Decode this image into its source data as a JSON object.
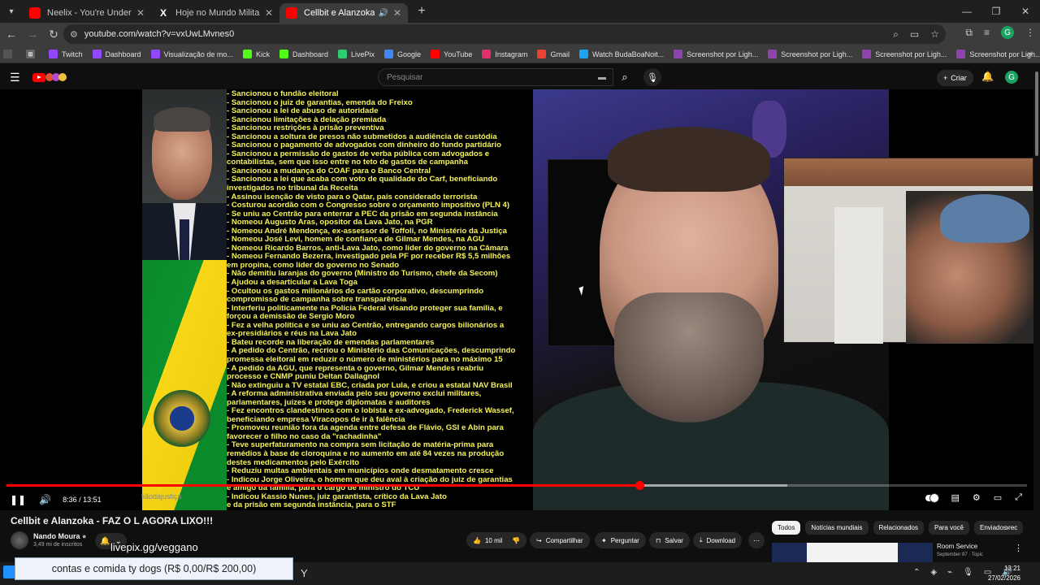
{
  "browser": {
    "tabs": [
      {
        "title": "Neelix - You're Under Control (...",
        "icon": "youtube-icon",
        "active": false
      },
      {
        "title": "Hoje no Mundo Militar (@hoje...",
        "icon": "x-icon",
        "active": false
      },
      {
        "title": "Cellbit e Alanzoka - FAZ O L...",
        "icon": "youtube-icon",
        "active": true
      }
    ],
    "url": "youtube.com/watch?v=vxUwLMvnes0",
    "bookmarks": [
      {
        "label": "Twitch",
        "color": "#9146ff"
      },
      {
        "label": "Dashboard",
        "color": "#9146ff"
      },
      {
        "label": "Visualização de mo...",
        "color": "#9146ff"
      },
      {
        "label": "Kick",
        "color": "#53fc18"
      },
      {
        "label": "Dashboard",
        "color": "#53fc18"
      },
      {
        "label": "LivePix",
        "color": "#2ecc71"
      },
      {
        "label": "Google",
        "color": "#4285f4"
      },
      {
        "label": "YouTube",
        "color": "#ff0000"
      },
      {
        "label": "Instagram",
        "color": "#e1306c"
      },
      {
        "label": "Gmail",
        "color": "#ea4335"
      },
      {
        "label": "Watch BudaBoaNoit...",
        "color": "#1da1f2"
      },
      {
        "label": "Screenshot por Ligh...",
        "color": "#8e44ad"
      },
      {
        "label": "Screenshot por Ligh...",
        "color": "#8e44ad"
      },
      {
        "label": "Screenshot por Ligh...",
        "color": "#8e44ad"
      },
      {
        "label": "Screenshot por Ligh...",
        "color": "#8e44ad"
      }
    ]
  },
  "youtube": {
    "search_placeholder": "Pesquisar",
    "create_label": "Criar",
    "avatar_letter": "G"
  },
  "video": {
    "text_lines": [
      "- Sancionou o fundão eleitoral",
      "- Sancionou o juiz de garantias, emenda do Freixo",
      "- Sancionou a lei de abuso de autoridade",
      "- Sancionou limitações à delação premiada",
      "- Sancionou restrições à prisão preventiva",
      "- Sancionou a soltura de presos não submetidos a audiência de custódia",
      "- Sancionou o pagamento de advogados com dinheiro do fundo partidário",
      "- Sancionou a permissão de gastos de verba pública com advogados e",
      "contabilistas, sem que isso entre no teto de gastos de campanha",
      "- Sancionou a mudança do COAF para o Banco Central",
      "- Sancionou a lei que acaba com voto de qualidade do Carf, beneficiando",
      "investigados no tribunal da Receita",
      "- Assinou isenção de visto para o Qatar, país considerado terrorista",
      "- Costurou acordão com o Congresso sobre o orçamento impositivo (PLN 4)",
      "- Se uniu ao Centrão para enterrar a PEC da prisão em segunda instância",
      "- Nomeou Augusto Aras, opositor da Lava Jato, na PGR",
      "- Nomeou André Mendonça, ex-assessor de Toffoli, no Ministério da Justiça",
      "- Nomeou José Levi, homem de confiança de Gilmar Mendes, na AGU",
      "- Nomeou Ricardo Barros, anti-Lava Jato, como líder do governo na Câmara",
      "- Nomeou Fernando Bezerra, investigado pela PF por receber R$ 5,5 milhões",
      "em propina, como líder do governo no Senado",
      "- Não demitiu laranjas do governo (Ministro do Turismo, chefe da Secom)",
      "- Ajudou a desarticular a Lava Toga",
      "- Ocultou os gastos milionários do cartão corporativo, descumprindo",
      "compromisso de campanha sobre transparência",
      "- Interferiu politicamente na Polícia Federal visando proteger sua família, e",
      "forçou a demissão de Sergio Moro",
      "- Fez a velha política e se uniu ao Centrão, entregando cargos bilionários a",
      "ex-presidiários e réus na Lava Jato",
      "- Bateu recorde na liberação de emendas parlamentares",
      "- A pedido do Centrão, recriou o Ministério das Comunicações, descumprindo",
      "promessa eleitoral em reduzir o número de ministérios para no máximo 15",
      "- A pedido da AGU, que representa o governo, Gilmar Mendes reabriu",
      "processo e CNMP puniu Deltan Dallagnol",
      "- Não extinguiu a TV estatal EBC, criada por Lula, e criou a estatal NAV Brasil",
      "- A reforma administrativa enviada pelo seu governo exclui militares,",
      "parlamentares, juízes e protege diplomatas e auditores",
      "- Fez encontros clandestinos com o lobista e ex-advogado, Frederick Wassef,",
      "beneficiando empresa Viracopos de ir à falência",
      "- Promoveu reunião fora da agenda entre defesa de Flávio, GSI e Abin para",
      "favorecer o filho no caso da \"rachadinha\"",
      "- Teve superfaturamento na compra sem licitação de matéria-prima para",
      "remédios à base de cloroquina e no aumento em até 84 vezes na produção",
      "destes medicamentos pelo Exército",
      "- Reduziu multas ambientais em municípios onde desmatamento cresce",
      "- Indicou Jorge Oliveira, o homem que deu aval à criação do juiz de garantias",
      "e amigo da família, para o cargo de ministro do TCU",
      "- Indicou Kassio Nunes, juiz garantista, crítico da Lava Jato",
      "e da prisão em segunda instância, para o STF"
    ],
    "watermark": "liãodajustiça",
    "current_time": "8:36",
    "duration": "13:51",
    "played_fraction": 0.62,
    "loaded_fraction": 0.765,
    "title": "Cellbit e Alanzoka - FAZ O L AGORA LIXO!!!",
    "channel_name": "Nando Moura",
    "subscribers": "3,49 mi de inscritos",
    "overlay_link": "livepix.gg/veggano",
    "likes": "10 mil",
    "share_label": "Compartilhar",
    "ask_label": "Perguntar",
    "save_label": "Salvar",
    "download_label": "Download",
    "donation_text": "contas e comida ty dogs (R$ 0,00/R$ 200,00)"
  },
  "sidebar": {
    "chips": [
      "Todos",
      "Notícias mundiais",
      "Relacionados",
      "Para você",
      "Enviados rec"
    ],
    "rec_title": "Room Service",
    "rec_sub": "September 87 · Topic"
  },
  "taskbar": {
    "time": "13:21",
    "date": "27/02/2026"
  }
}
